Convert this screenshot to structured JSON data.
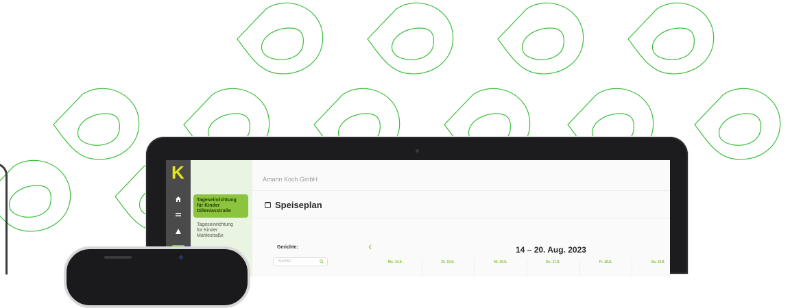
{
  "colors": {
    "accent": "#8cc43f",
    "logo": "#e4e61f",
    "pattern_stroke": "#3bbf3b"
  },
  "app": {
    "logo": "K",
    "company": "Amann Koch GmbH",
    "page_title": "Speiseplan",
    "rail_icons": [
      "home-icon",
      "menu-icon",
      "chart-icon",
      "calendar-icon"
    ]
  },
  "nav": {
    "items": [
      {
        "label_lines": [
          "Tageseinrichtung",
          "für Kinder",
          "Dilleniasstraße"
        ],
        "active": true
      },
      {
        "label_lines": [
          "Tageseinrichtung",
          "für Kinder",
          "Mahlestraße"
        ],
        "active": false
      }
    ]
  },
  "filters": {
    "title": "Gerichte:",
    "search_placeholder": "Suchen"
  },
  "calendar": {
    "week_label": "14 – 20. Aug. 2023",
    "days": [
      "Mo. 14.8.",
      "Di. 15.8.",
      "Mi. 16.8.",
      "Do. 17.8.",
      "Fr. 18.8.",
      "Sa. 19.8."
    ]
  }
}
